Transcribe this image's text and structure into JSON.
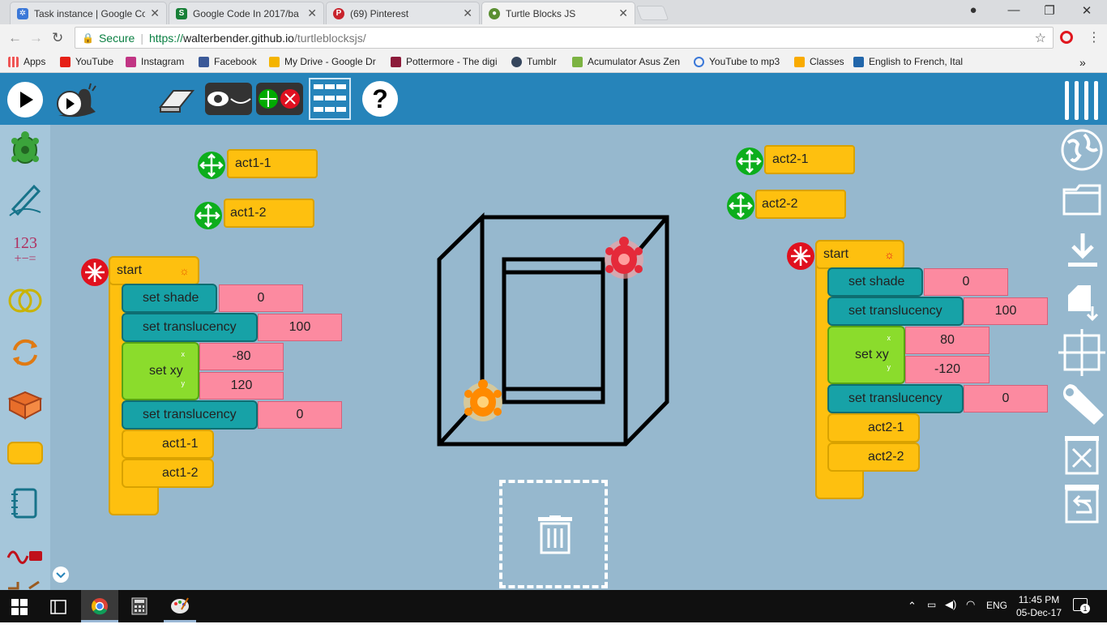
{
  "tabs": [
    {
      "title": "Task instance | Google Co",
      "icon": "gear-icon"
    },
    {
      "title": "Google Code In 2017/ba",
      "icon": "s-icon"
    },
    {
      "title": "(69) Pinterest",
      "icon": "pinterest-icon"
    },
    {
      "title": "Turtle Blocks JS",
      "icon": "turtle-icon"
    }
  ],
  "address": {
    "secure": "Secure",
    "scheme": "https://",
    "host": "walterbender.github.io",
    "path": "/turtleblocksjs/"
  },
  "bookmarks": [
    "Apps",
    "YouTube",
    "Instagram",
    "Facebook",
    "My Drive - Google Dr",
    "Pottermore - The digi",
    "Tumblr",
    "Acumulator Asus Zen",
    "YouTube to mp3",
    "Classes",
    "English to French, Ital"
  ],
  "blocks": {
    "act1_1": "act1-1",
    "act1_2": "act1-2",
    "act2_1": "act2-1",
    "act2_2": "act2-2",
    "start": "start",
    "set_shade": "set shade",
    "set_translucency": "set translucency",
    "set_xy": "set xy",
    "x": "x",
    "y": "y",
    "left": {
      "shade": "0",
      "trans1": "100",
      "x": "-80",
      "y": "120",
      "trans2": "0",
      "call1": "act1-1",
      "call2": "act1-2"
    },
    "right": {
      "shade": "0",
      "trans1": "100",
      "x": "80",
      "y": "-120",
      "trans2": "0",
      "call1": "act2-1",
      "call2": "act2-2"
    }
  },
  "colors": {
    "toolbar": "#2684ba",
    "canvas": "#96b8ce",
    "palette": "#a5c6da",
    "action_block": "#fec00f",
    "pen_block": "#17a2a7",
    "graphics_block": "#8bdc2c",
    "number_block": "#fc8aa0"
  },
  "taskbar": {
    "time": "11:45 PM",
    "date": "05-Dec-17",
    "lang": "ENG",
    "notifications": "1"
  }
}
